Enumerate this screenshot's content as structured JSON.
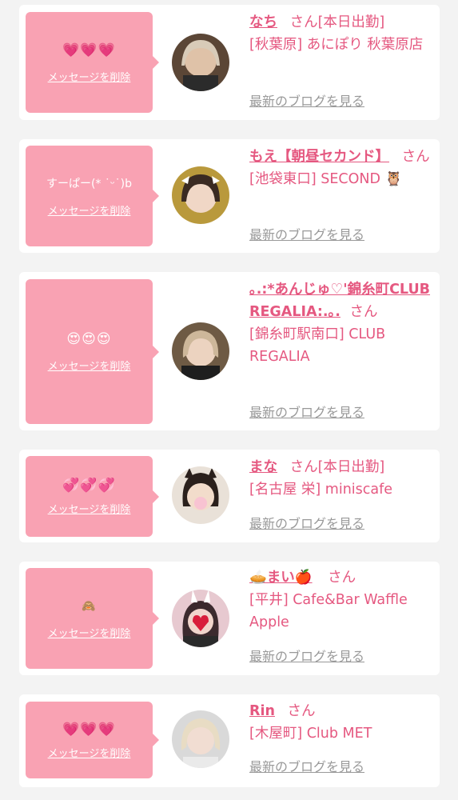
{
  "delete_label": "メッセージを削除",
  "blog_label": "最新のブログを見る",
  "cards": [
    {
      "message": "💗💗💗",
      "name": "なち",
      "san": "さん",
      "attend": "[本日出勤]",
      "area_shop": "[秋葉原] あにぽり 秋葉原店"
    },
    {
      "message": "すーぱー(* ˙ᵕ˙)b",
      "name": "もえ【朝昼セカンド】",
      "san": "さん",
      "attend": "",
      "area_shop": "[池袋東口] SECOND 🦉"
    },
    {
      "message": "😍😍😍",
      "name": "｡.:*あんじゅ♡'錦糸町CLUB REGALIA:.｡.",
      "san": "さん",
      "attend": "",
      "area_shop": "[錦糸町駅南口] CLUB REGALIA"
    },
    {
      "message": "💞💞💞",
      "name": "まな",
      "san": "さん",
      "attend": "[本日出勤]",
      "area_shop": "[名古屋 栄] miniscafe"
    },
    {
      "message": "🙈",
      "name": "🥧まい🍎",
      "san": "さん",
      "attend": "",
      "area_shop": "[平井] Cafe&Bar Waffle Apple"
    },
    {
      "message": "💗💗💗",
      "name": "Rin",
      "san": "さん",
      "attend": "",
      "area_shop": "[木屋町] Club MET"
    }
  ]
}
